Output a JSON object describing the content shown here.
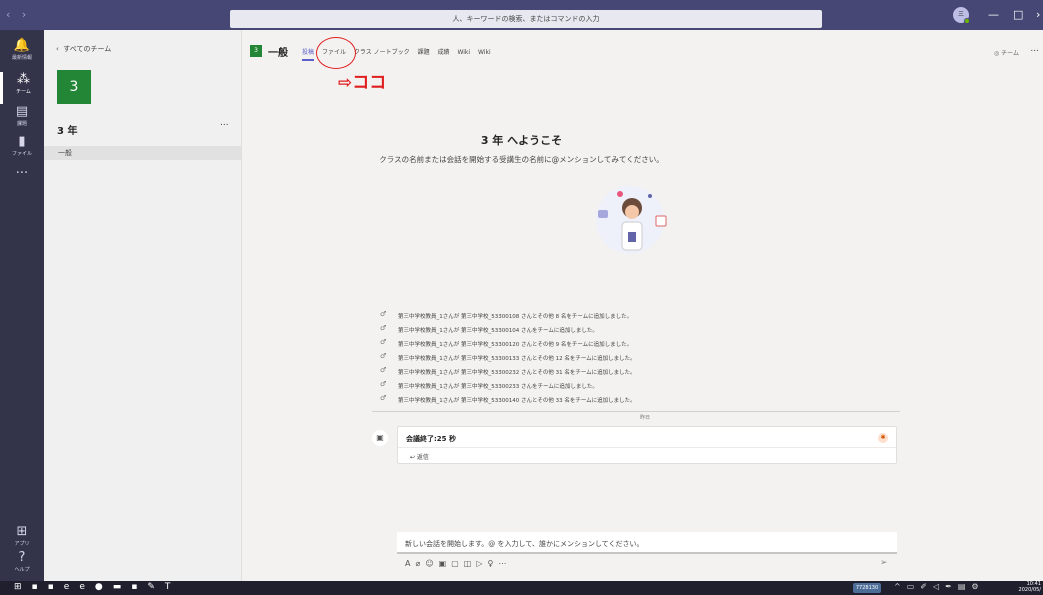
{
  "window": {
    "search_placeholder": "人、キーワードの検索、またはコマンドの入力",
    "user_initials": "三"
  },
  "rail": [
    {
      "icon": "bell-icon",
      "label": "最新情報"
    },
    {
      "icon": "teams-icon",
      "label": "チーム"
    },
    {
      "icon": "calendar-icon",
      "label": "課題"
    },
    {
      "icon": "file-icon",
      "label": "ファイル"
    },
    {
      "icon": "more-icon",
      "label": "..."
    },
    {
      "icon": "apps-icon",
      "label": "アプリ"
    },
    {
      "icon": "help-icon",
      "label": "ヘルプ"
    }
  ],
  "teampanel": {
    "back_label": "すべてのチーム",
    "tile_text": "3",
    "team_name": "3 年",
    "more": "...",
    "channel": "一般"
  },
  "header": {
    "tile_text": "3",
    "title": "一般",
    "tabs": [
      "投稿",
      "ファイル",
      "クラス ノートブック",
      "課題",
      "成績",
      "Wiki",
      "Wiki"
    ],
    "team_button": "◎ チーム",
    "more": "..."
  },
  "annotation": {
    "text": "⇨ココ"
  },
  "welcome": {
    "title": "3 年 へようこそ",
    "subtitle": "クラスの名前または会話を開始する受講生の名前に@メンションしてみてください。"
  },
  "activity": [
    "第三中学校教員_1さんが 第三中学校_53300108 さんとその他 8 名をチームに追加しました。",
    "第三中学校教員_1さんが 第三中学校_53300104 さんをチームに追加しました。",
    "第三中学校教員_1さんが 第三中学校_53300120 さんとその他 9 名をチームに追加しました。",
    "第三中学校教員_1さんが 第三中学校_53300133 さんとその他 12 名をチームに追加しました。",
    "第三中学校教員_1さんが 第三中学校_53300232 さんとその他 31 名をチームに追加しました。",
    "第三中学校教員_1さんが 第三中学校_53300233 さんをチームに追加しました。",
    "第三中学校教員_1さんが 第三中学校_53300140 さんとその他 33 名をチームに追加しました。"
  ],
  "divider_label": "昨日",
  "meeting": {
    "title": "会議終了:25 秒",
    "reply": "↩ 返信"
  },
  "compose": {
    "placeholder": "新しい会話を開始します。@ を入力して、誰かにメンションしてください。"
  },
  "taskbar": {
    "ime_text": "7728130",
    "time": "10:41",
    "date": "2020/05/"
  }
}
